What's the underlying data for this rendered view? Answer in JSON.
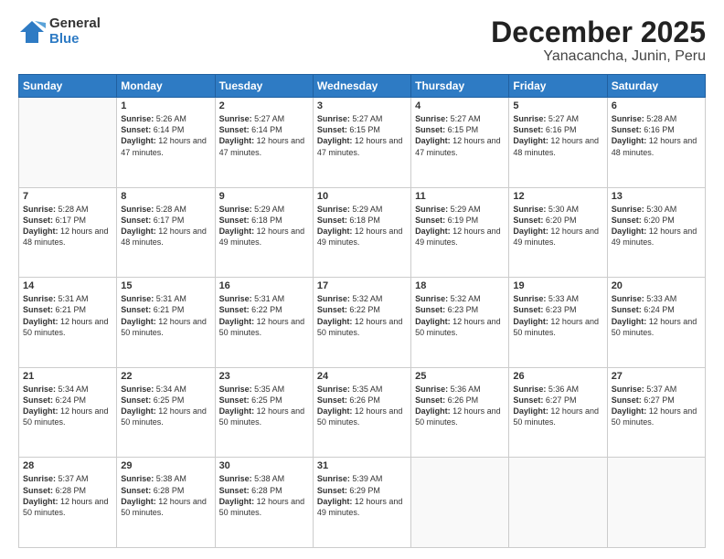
{
  "logo": {
    "general": "General",
    "blue": "Blue"
  },
  "title": "December 2025",
  "subtitle": "Yanacancha, Junin, Peru",
  "weekdays": [
    "Sunday",
    "Monday",
    "Tuesday",
    "Wednesday",
    "Thursday",
    "Friday",
    "Saturday"
  ],
  "weeks": [
    [
      {
        "day": "",
        "info": ""
      },
      {
        "day": "1",
        "info": "Sunrise: 5:26 AM\nSunset: 6:14 PM\nDaylight: 12 hours and 47 minutes."
      },
      {
        "day": "2",
        "info": "Sunrise: 5:27 AM\nSunset: 6:14 PM\nDaylight: 12 hours and 47 minutes."
      },
      {
        "day": "3",
        "info": "Sunrise: 5:27 AM\nSunset: 6:15 PM\nDaylight: 12 hours and 47 minutes."
      },
      {
        "day": "4",
        "info": "Sunrise: 5:27 AM\nSunset: 6:15 PM\nDaylight: 12 hours and 47 minutes."
      },
      {
        "day": "5",
        "info": "Sunrise: 5:27 AM\nSunset: 6:16 PM\nDaylight: 12 hours and 48 minutes."
      },
      {
        "day": "6",
        "info": "Sunrise: 5:28 AM\nSunset: 6:16 PM\nDaylight: 12 hours and 48 minutes."
      }
    ],
    [
      {
        "day": "7",
        "info": "Sunrise: 5:28 AM\nSunset: 6:17 PM\nDaylight: 12 hours and 48 minutes."
      },
      {
        "day": "8",
        "info": "Sunrise: 5:28 AM\nSunset: 6:17 PM\nDaylight: 12 hours and 48 minutes."
      },
      {
        "day": "9",
        "info": "Sunrise: 5:29 AM\nSunset: 6:18 PM\nDaylight: 12 hours and 49 minutes."
      },
      {
        "day": "10",
        "info": "Sunrise: 5:29 AM\nSunset: 6:18 PM\nDaylight: 12 hours and 49 minutes."
      },
      {
        "day": "11",
        "info": "Sunrise: 5:29 AM\nSunset: 6:19 PM\nDaylight: 12 hours and 49 minutes."
      },
      {
        "day": "12",
        "info": "Sunrise: 5:30 AM\nSunset: 6:20 PM\nDaylight: 12 hours and 49 minutes."
      },
      {
        "day": "13",
        "info": "Sunrise: 5:30 AM\nSunset: 6:20 PM\nDaylight: 12 hours and 49 minutes."
      }
    ],
    [
      {
        "day": "14",
        "info": "Sunrise: 5:31 AM\nSunset: 6:21 PM\nDaylight: 12 hours and 50 minutes."
      },
      {
        "day": "15",
        "info": "Sunrise: 5:31 AM\nSunset: 6:21 PM\nDaylight: 12 hours and 50 minutes."
      },
      {
        "day": "16",
        "info": "Sunrise: 5:31 AM\nSunset: 6:22 PM\nDaylight: 12 hours and 50 minutes."
      },
      {
        "day": "17",
        "info": "Sunrise: 5:32 AM\nSunset: 6:22 PM\nDaylight: 12 hours and 50 minutes."
      },
      {
        "day": "18",
        "info": "Sunrise: 5:32 AM\nSunset: 6:23 PM\nDaylight: 12 hours and 50 minutes."
      },
      {
        "day": "19",
        "info": "Sunrise: 5:33 AM\nSunset: 6:23 PM\nDaylight: 12 hours and 50 minutes."
      },
      {
        "day": "20",
        "info": "Sunrise: 5:33 AM\nSunset: 6:24 PM\nDaylight: 12 hours and 50 minutes."
      }
    ],
    [
      {
        "day": "21",
        "info": "Sunrise: 5:34 AM\nSunset: 6:24 PM\nDaylight: 12 hours and 50 minutes."
      },
      {
        "day": "22",
        "info": "Sunrise: 5:34 AM\nSunset: 6:25 PM\nDaylight: 12 hours and 50 minutes."
      },
      {
        "day": "23",
        "info": "Sunrise: 5:35 AM\nSunset: 6:25 PM\nDaylight: 12 hours and 50 minutes."
      },
      {
        "day": "24",
        "info": "Sunrise: 5:35 AM\nSunset: 6:26 PM\nDaylight: 12 hours and 50 minutes."
      },
      {
        "day": "25",
        "info": "Sunrise: 5:36 AM\nSunset: 6:26 PM\nDaylight: 12 hours and 50 minutes."
      },
      {
        "day": "26",
        "info": "Sunrise: 5:36 AM\nSunset: 6:27 PM\nDaylight: 12 hours and 50 minutes."
      },
      {
        "day": "27",
        "info": "Sunrise: 5:37 AM\nSunset: 6:27 PM\nDaylight: 12 hours and 50 minutes."
      }
    ],
    [
      {
        "day": "28",
        "info": "Sunrise: 5:37 AM\nSunset: 6:28 PM\nDaylight: 12 hours and 50 minutes."
      },
      {
        "day": "29",
        "info": "Sunrise: 5:38 AM\nSunset: 6:28 PM\nDaylight: 12 hours and 50 minutes."
      },
      {
        "day": "30",
        "info": "Sunrise: 5:38 AM\nSunset: 6:28 PM\nDaylight: 12 hours and 50 minutes."
      },
      {
        "day": "31",
        "info": "Sunrise: 5:39 AM\nSunset: 6:29 PM\nDaylight: 12 hours and 49 minutes."
      },
      {
        "day": "",
        "info": ""
      },
      {
        "day": "",
        "info": ""
      },
      {
        "day": "",
        "info": ""
      }
    ]
  ]
}
